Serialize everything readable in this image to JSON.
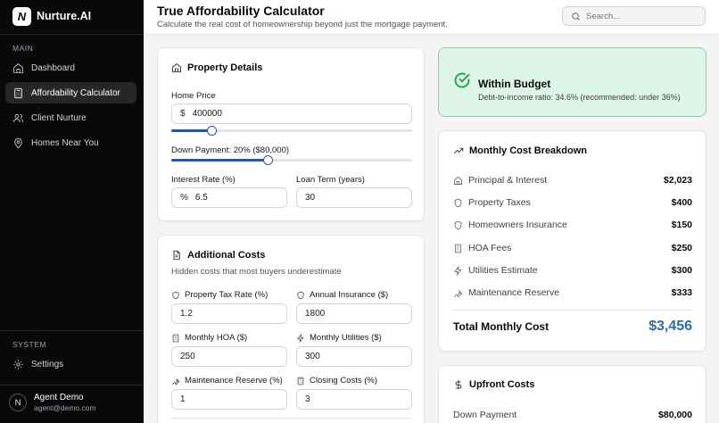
{
  "app": {
    "name": "Nurture.AI",
    "logo_letter": "N"
  },
  "sidebar": {
    "main_label": "MAIN",
    "items": [
      {
        "label": "Dashboard",
        "icon": "home-icon",
        "active": false
      },
      {
        "label": "Affordability Calculator",
        "icon": "calculator-icon",
        "active": true
      },
      {
        "label": "Client Nurture",
        "icon": "users-icon",
        "active": false
      },
      {
        "label": "Homes Near You",
        "icon": "map-pin-icon",
        "active": false
      }
    ],
    "system_label": "SYSTEM",
    "settings_label": "Settings",
    "user": {
      "initial": "N",
      "name": "Agent Demo",
      "email": "agent@demo.com"
    }
  },
  "header": {
    "title": "True Affordability Calculator",
    "subtitle": "Calculate the real cost of homeownership beyond just the mortgage payment.",
    "search_placeholder": "Search..."
  },
  "property": {
    "title": "Property Details",
    "home_price_label": "Home Price",
    "home_price_prefix": "$",
    "home_price_value": "400000",
    "home_price_slider_fraction": 0.17,
    "down_payment_label": "Down Payment: 20% ($80,000)",
    "down_payment_slider_fraction": 0.4,
    "interest_label": "Interest Rate (%)",
    "interest_prefix": "%",
    "interest_value": "6.5",
    "loan_term_label": "Loan Term (years)",
    "loan_term_value": "30"
  },
  "additional": {
    "title": "Additional Costs",
    "subtitle": "Hidden costs that most buyers underestimate",
    "tax_label": "Property Tax Rate (%)",
    "tax_value": "1.2",
    "insurance_label": "Annual Insurance ($)",
    "insurance_value": "1800",
    "hoa_label": "Monthly HOA ($)",
    "hoa_value": "250",
    "utilities_label": "Monthly Utilities ($)",
    "utilities_value": "300",
    "maintenance_label": "Maintenance Reserve (%)",
    "maintenance_value": "1",
    "closing_label": "Closing Costs (%)",
    "closing_value": "3"
  },
  "budget": {
    "title": "Within Budget",
    "subtitle": "Debt-to-income ratio: 34.6% (recommended: under 36%)",
    "color": "#16a34a"
  },
  "breakdown": {
    "title": "Monthly Cost Breakdown",
    "rows": [
      {
        "label": "Principal & Interest",
        "value": "$2,023",
        "icon": "home-icon"
      },
      {
        "label": "Property Taxes",
        "value": "$400",
        "icon": "shield-icon"
      },
      {
        "label": "Homeowners Insurance",
        "value": "$150",
        "icon": "shield-icon"
      },
      {
        "label": "HOA Fees",
        "value": "$250",
        "icon": "building-icon"
      },
      {
        "label": "Utilities Estimate",
        "value": "$300",
        "icon": "zap-icon"
      },
      {
        "label": "Maintenance Reserve",
        "value": "$333",
        "icon": "wrench-icon"
      }
    ],
    "total_label": "Total Monthly Cost",
    "total_value": "$3,456",
    "total_color": "#2b6cb0"
  },
  "upfront": {
    "title": "Upfront Costs",
    "down_payment_label": "Down Payment",
    "down_payment_value": "$80,000"
  }
}
